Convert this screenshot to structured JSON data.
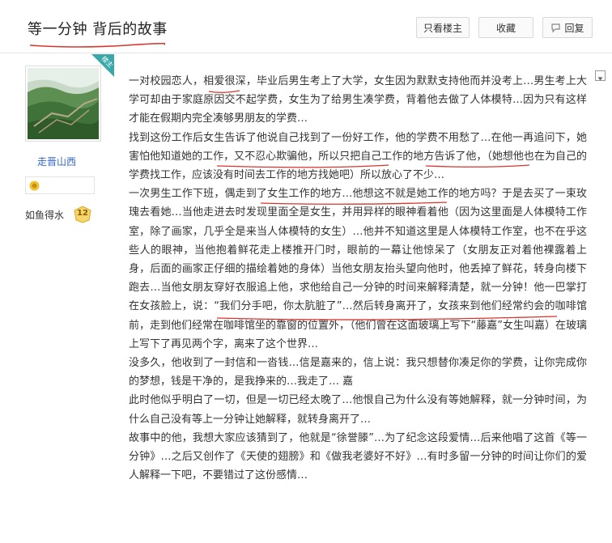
{
  "header": {
    "title": "等一分钟 背后的故事",
    "buttons": {
      "only_op": "只看楼主",
      "favorite": "收藏",
      "reply": "回复"
    }
  },
  "sidebar": {
    "op_badge": "楼主",
    "username": "走晋山西",
    "level_label": "如鱼得水",
    "level_num": "12"
  },
  "post": {
    "paragraphs": [
      "一对校园恋人，相爱很深，毕业后男生考上了大学，女生因为默默支持他而并没考上…男生考上大学可却由于家庭原因交不起学费，女生为了给男生凑学费，背着他去做了人体模特…因为只有这样才能在假期内完全凑够男朋友的学费…",
      "找到这份工作后女生告诉了他说自己找到了一份好工作，他的学费不用愁了…在他一再追问下，她害怕他知道她的工作，又不忍心欺骗他，所以只把自己工作的地方告诉了他，（她想他也在为自己的学费找工作，应该没有时间去工作的地方找她吧）所以放心了不少…",
      "一次男生工作下班，偶走到了女生工作的地方…他想这不就是她工作的地方吗？于是去买了一束玫瑰去看她…当他走进去时发现里面全是女生，并用异样的眼神看着他（因为这里面是人体模特工作室，除了画家，几乎全是来当人体模特的女生）…他并不知道这里是人体模特工作室，也不在乎这些人的眼神，当他抱着鲜花走上楼推开门时，眼前的一幕让他惊呆了（女朋友正对着他裸露着上身，后面的画家正仔细的描绘着她的身体）当他女朋友抬头望向他时，他丢掉了鲜花，转身向楼下跑去…当他女朋友穿好衣服追上他，求他给自己一分钟的时间来解释清楚，就一分钟！他一巴掌打在女孩脸上，说：“我们分手吧，你太肮脏了”…然后转身离开了，女孩来到他们经常约会的咖啡馆前，走到他们经常在咖啡馆坐的靠窗的位置外，（他们曾在这面玻璃上写下“藤嘉”女生叫嘉）在玻璃上写下了再见两个字，离来了这个世界…",
      "没多久，他收到了一封信和一沓钱…信是嘉来的，信上说：我只想替你凑足你的学费，让你完成你的梦想，钱是干净的，是我挣来的…我走了… 嘉",
      "此时他似乎明白了一切，但是一切已经太晚了…他恨自己为什么没有等她解释，就一分钟时间，为什么自己没有等上一分钟让她解释，就转身离开了…",
      "故事中的他，我想大家应该猜到了，他就是“徐誉滕”…为了纪念这段爱情…后来他唱了这首《等一分钟》…之后又创作了《天使的翅膀》和《做我老婆好不好》…有时多留一分钟的时间让你们的爱人解释一下吧，不要错过了这份感情…"
    ]
  },
  "colors": {
    "link_blue": "#3366cc",
    "ink_red": "#d9352b",
    "badge_teal": "#3aa8a8"
  },
  "icons": [
    "reply-icon",
    "avatar-landscape",
    "status-icon",
    "level-badge-icon",
    "collapse-arrow-icon",
    "op-corner-badge"
  ]
}
